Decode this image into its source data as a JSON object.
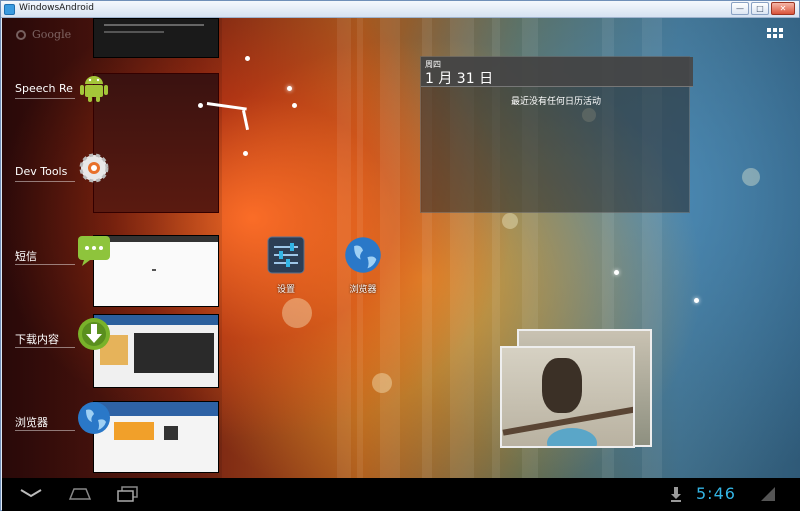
{
  "window": {
    "title": "WindowsAndroid",
    "min_label": "—",
    "max_label": "□",
    "close_label": "✕"
  },
  "launcher": {
    "search_hint": "Google"
  },
  "recent_apps": [
    {
      "label": "Speech Recognizer",
      "icon": "android-robot-icon"
    },
    {
      "label": "Dev Tools",
      "icon": "dev-tools-gear-icon"
    },
    {
      "label": "短信",
      "icon": "messaging-icon"
    },
    {
      "label": "下载内容",
      "icon": "download-icon"
    },
    {
      "label": "浏览器",
      "icon": "browser-globe-icon"
    }
  ],
  "calendar": {
    "weekday": "周四",
    "date": "1 月 31 日",
    "empty_text": "最近没有任何日历活动"
  },
  "desktop_icons": [
    {
      "label": "设置",
      "icon": "settings-sliders-icon"
    },
    {
      "label": "浏览器",
      "icon": "browser-globe-icon"
    }
  ],
  "status": {
    "time": "5:46"
  },
  "colors": {
    "accent": "#33b5e5",
    "titlebar": "#d6e2f1"
  }
}
